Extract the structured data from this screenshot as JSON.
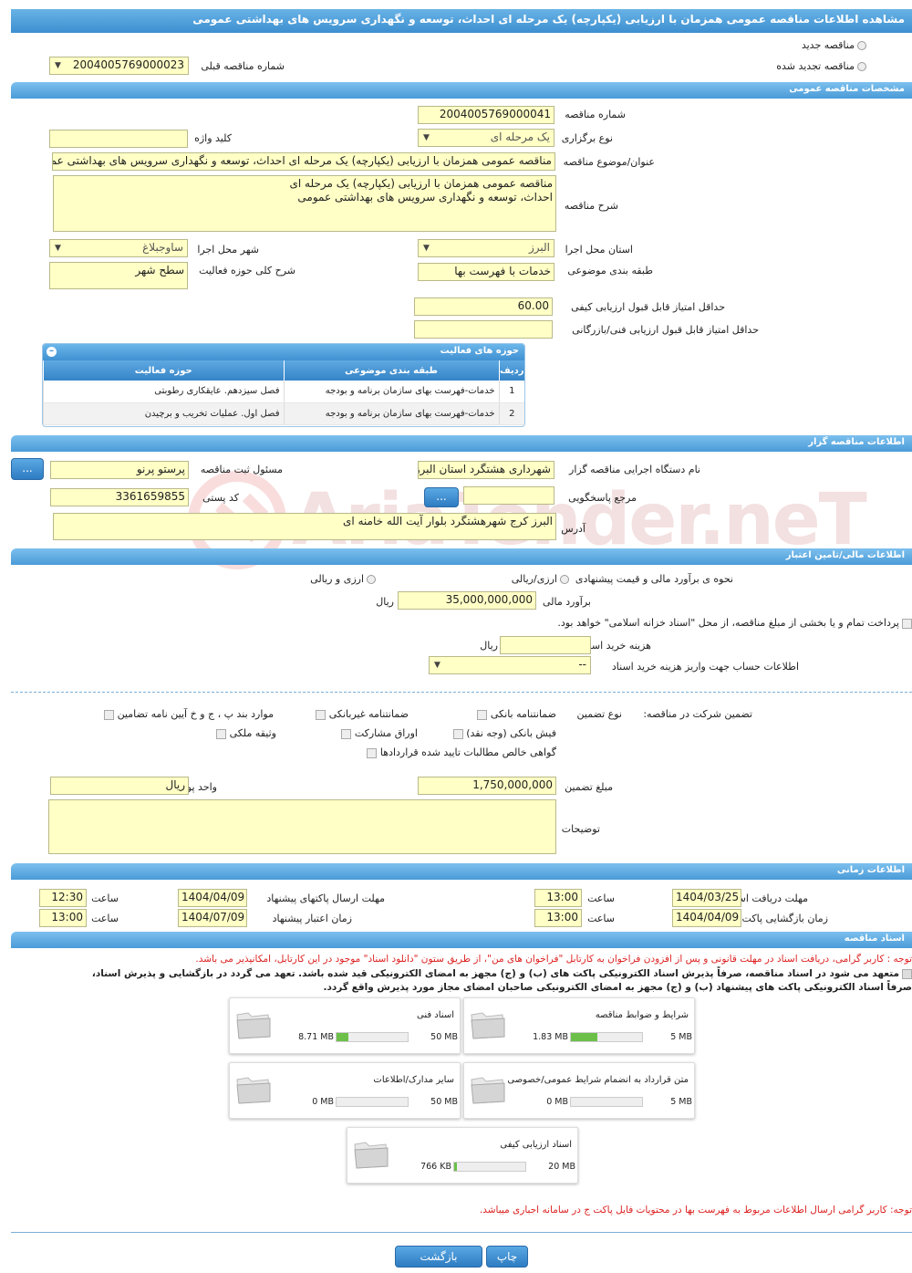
{
  "header": {
    "title": "مشاهده اطلاعات مناقصه عمومی همزمان با ارزیابی (یکپارچه) یک مرحله ای احداث، توسعه و نگهداری سرویس های بهداشتی عمومی"
  },
  "tender_type": {
    "new_label": "مناقصه جدید",
    "renewed_label": "مناقصه تجدید شده",
    "prev_label": "شماره مناقصه قبلی",
    "prev_value": "2004005769000023"
  },
  "general": {
    "section_title": "مشخصات مناقصه عمومی",
    "number_label": "شماره مناقصه",
    "number_value": "2004005769000041",
    "hold_type_label": "نوع برگزاری",
    "hold_type_value": "یک مرحله ای",
    "keyword_label": "کلید واژه",
    "keyword_value": "",
    "subject_label": "عنوان/موضوع مناقصه",
    "subject_value": "مناقصه عمومی همزمان با ارزیابی (یکپارچه) یک مرحله ای احداث، توسعه  و نگهداری سرویس های بهداشتی عمومی",
    "desc_label": "شرح مناقصه",
    "desc_line1": "مناقصه عمومی همزمان با ارزیابی (یکپارچه) یک مرحله ای",
    "desc_line2": "احداث، توسعه  و نگهداری سرویس های بهداشتی عمومی",
    "province_label": "استان محل اجرا",
    "province_value": "البرز",
    "city_label": "شهر محل اجرا",
    "city_value": "ساوجبلاغ",
    "category_label": "طبقه بندی موضوعی",
    "category_value": "خدمات با فهرست بها",
    "scope_desc_label": "شرح کلی حوزه فعالیت",
    "scope_desc_value": "سطح شهر",
    "min_quality_label": "حداقل امتیاز قابل قبول ارزیابی کیفی",
    "min_quality_value": "60.00",
    "min_tech_label": "حداقل امتیاز قابل قبول ارزیابی فنی/بازرگانی",
    "min_tech_value": ""
  },
  "activity_table": {
    "title": "حوزه های فعالیت",
    "headers": [
      "ردیف",
      "طبقه بندی موضوعی",
      "حوزه فعالیت"
    ],
    "rows": [
      [
        "1",
        "خدمات-فهرست بهای سازمان برنامه و بودجه",
        "فصل سیزدهم. عایقکاری رطوبتی"
      ],
      [
        "2",
        "خدمات-فهرست بهای سازمان برنامه و بودجه",
        "فصل اول. عملیات تخریب و برچیدن"
      ]
    ]
  },
  "organizer": {
    "section_title": "اطلاعات مناقصه گزار",
    "org_label": "نام دستگاه اجرایی مناقصه گزار",
    "org_value": "شهرداری هشتگرد استان البرز",
    "registrar_label": "مسئول ثبت مناقصه",
    "registrar_value": "پرستو پرنو",
    "ref_label": "مرجع پاسخگویی",
    "ref_value": "",
    "postal_label": "کد پستی",
    "postal_value": "3361659855",
    "address_label": "آدرس",
    "address_value": "البرز کرج شهرهشتگرد بلوار آیت الله خامنه ای",
    "dots": "..."
  },
  "finance": {
    "section_title": "اطلاعات مالی/تامین اعتبار",
    "method_label": "نحوه ی برآورد مالی و قیمت پیشنهادی",
    "opt1": "ارزی/ریالی",
    "opt2": "ارزی و ریالی",
    "estimate_label": "برآورد مالی",
    "estimate_value": "35,000,000,000",
    "currency": "ریال",
    "treasury_text": "پرداخت تمام و یا بخشی از مبلغ مناقصه، از محل \"اسناد خزانه اسلامی\" خواهد بود.",
    "doc_cost_label": "هزینه خرید اسناد",
    "doc_cost_value": "",
    "doc_cost_unit": "ریال",
    "account_label": "اطلاعات حساب جهت واریز هزینه خرید اسناد",
    "account_value": "--"
  },
  "guarantee": {
    "label": "تضمین شرکت در مناقصه:",
    "type_label": "نوع تضمین",
    "opts": [
      "ضمانتنامه بانکی",
      "ضمانتنامه غیربانکی",
      "موارد بند پ ، ج و خ آیین نامه تضامین",
      "فیش بانکی (وجه نقد)",
      "اوراق مشارکت",
      "وثیقه ملکی",
      "گواهی خالص مطالبات تایید شده قراردادها"
    ],
    "amount_label": "مبلغ تضمین",
    "amount_value": "1,750,000,000",
    "unit_label": "واحد پول",
    "unit_value": "ریال",
    "notes_label": "توضیحات",
    "notes_value": ""
  },
  "timing": {
    "section_title": "اطلاعات زمانی",
    "receive_label": "مهلت دریافت اسناد",
    "receive_date": "1404/03/25",
    "receive_time": "13:00",
    "send_label": "مهلت ارسال پاکتهای پیشنهاد",
    "send_date": "1404/04/09",
    "send_time": "12:30",
    "open_label": "زمان بازگشایی پاکت ها",
    "open_date": "1404/04/09",
    "open_time": "13:00",
    "validity_label": "زمان اعتبار پیشنهاد",
    "validity_date": "1404/07/09",
    "validity_time": "13:00",
    "time_label": "ساعت"
  },
  "documents": {
    "section_title": "اسناد مناقصه",
    "note_red": "توجه : کاربر گرامی، دریافت اسناد در مهلت قانونی و پس از افزودن فراخوان به کارتابل \"فراخوان های من\"، از طریق ستون \"دانلود اسناد\" موجود در این کارتابل، امکانپذیر می باشد.",
    "commit_line1": "متعهد می شود در اسناد مناقصه، صرفاً پذیرش اسناد الکترونیکی پاکت های (ب) و (ج) مجهز به امضای الکترونیکی قید شده باشد. تعهد می گردد در بازگشایی و پذیرش اسناد،",
    "commit_line2": "صرفاً اسناد الکترونیکی پاکت های پیشنهاد (ب) و (ج) مجهز به امضای الکترونیکی صاحبان امضای مجاز مورد پذیرش واقع گردد.",
    "cards": [
      {
        "title": "شرایط و ضوابط مناقصه",
        "cur": "1.83 MB",
        "max": "5 MB",
        "pct": 37
      },
      {
        "title": "اسناد فنی",
        "cur": "8.71 MB",
        "max": "50 MB",
        "pct": 17
      },
      {
        "title": "متن قرارداد به انضمام شرایط عمومی/خصوصی",
        "cur": "0 MB",
        "max": "5 MB",
        "pct": 0
      },
      {
        "title": "سایر مدارک/اطلاعات",
        "cur": "0 MB",
        "max": "50 MB",
        "pct": 0
      },
      {
        "title": "اسناد ارزیابی کیفی",
        "cur": "766 KB",
        "max": "20 MB",
        "pct": 4
      }
    ],
    "note_bottom": "توجه: کاربر گرامی ارسال اطلاعات مربوط به فهرست بها در محتویات فایل پاکت ج در سامانه اجباری میباشد."
  },
  "actions": {
    "print": "چاپ",
    "back": "بازگشت"
  },
  "watermark": "AriaTender.neT"
}
